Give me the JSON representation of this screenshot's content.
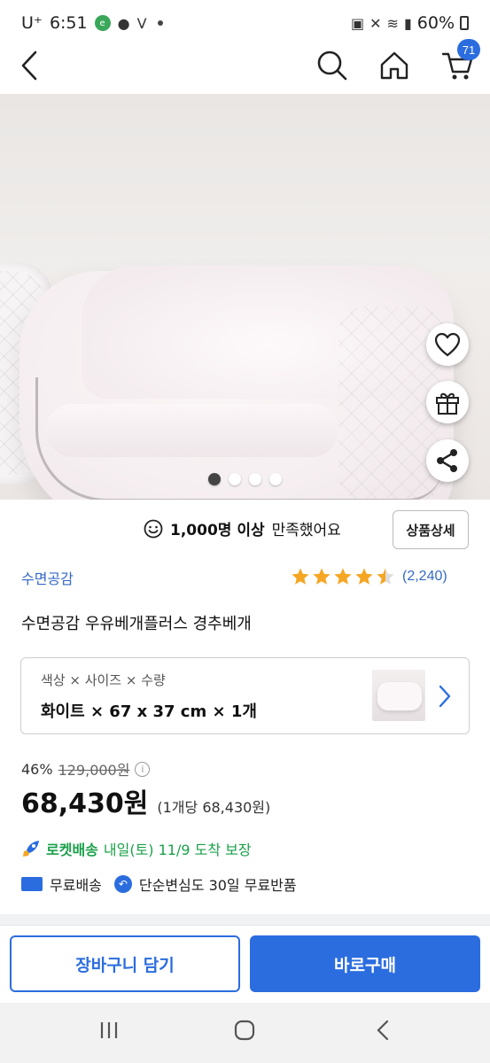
{
  "status_bar": {
    "carrier": "U⁺",
    "time": "6:51",
    "battery": "60%"
  },
  "nav": {
    "cart_count": "71"
  },
  "gallery": {
    "slide_count": 4,
    "active_slide": 1
  },
  "satisfaction": {
    "count": "1,000명 이상",
    "suffix": "만족했어요",
    "detail_button": "상품상세"
  },
  "product": {
    "brand": "수면공감",
    "rating": 4.5,
    "review_count": "(2,240)",
    "title": "수면공감 우유베개플러스 경추베개"
  },
  "option": {
    "label": "색상 × 사이즈 × 수량",
    "value": "화이트 × 67 x 37 cm × 1개"
  },
  "price": {
    "discount": "46%",
    "original": "129,000원",
    "current": "68,430원",
    "unit_price": "(1개당 68,430원)"
  },
  "delivery": {
    "rocket_label": "로켓배송",
    "eta": "내일(토) 11/9 도착 보장",
    "free_shipping": "무료배송",
    "return_policy": "단순변심도 30일 무료반품"
  },
  "actions": {
    "cart_button": "장바구니 담기",
    "buy_button": "바로구매"
  },
  "colors": {
    "accent": "#2b6ddf",
    "rocket_green": "#1aa04a",
    "star": "#f5a623",
    "brand_link": "#3468c5"
  }
}
